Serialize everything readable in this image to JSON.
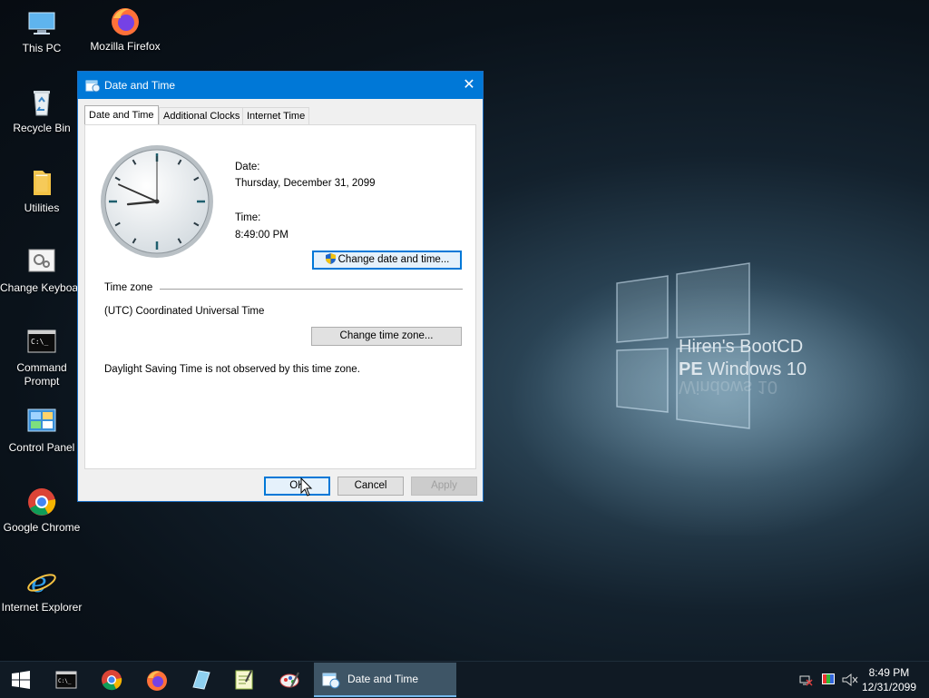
{
  "wallpaper": {
    "line1": "Hiren's BootCD",
    "line2_bold": "PE",
    "line2_rest": " Windows 10",
    "reflection": "Windows 10"
  },
  "desktop_icons": [
    {
      "label": "This PC",
      "icon": "computer-icon"
    },
    {
      "label": "Mozilla Firefox",
      "icon": "firefox-icon"
    },
    {
      "label": "Recycle Bin",
      "icon": "recycle-bin-icon"
    },
    {
      "label": "Utilities",
      "icon": "folder-icon"
    },
    {
      "label": "Change Keyboard Layout",
      "icon": "keyboard-settings-icon"
    },
    {
      "label": "Command Prompt",
      "icon": "cmd-icon"
    },
    {
      "label": "Control Panel",
      "icon": "control-panel-icon"
    },
    {
      "label": "Google Chrome",
      "icon": "chrome-icon"
    },
    {
      "label": "Internet Explorer",
      "icon": "ie-icon"
    }
  ],
  "dialog": {
    "title": "Date and Time",
    "close_glyph": "✕",
    "tabs": [
      "Date and Time",
      "Additional Clocks",
      "Internet Time"
    ],
    "date_label": "Date:",
    "date_value": "Thursday, December 31, 2099",
    "time_label": "Time:",
    "time_value": "8:49:00 PM",
    "change_datetime_button": "Change date and time...",
    "timezone_header": "Time zone",
    "timezone_value": "(UTC) Coordinated Universal Time",
    "change_timezone_button": "Change time zone...",
    "dst_note": "Daylight Saving Time is not observed by this time zone.",
    "ok_button": "OK",
    "cancel_button": "Cancel",
    "apply_button": "Apply"
  },
  "clock_face": {
    "hour": 8,
    "minute": 49,
    "second": 0
  },
  "taskbar": {
    "pinned": [
      "start-icon",
      "cmd-icon",
      "chrome-icon",
      "firefox-icon",
      "explorer-icon",
      "notepad-icon",
      "paint-icon"
    ],
    "active_window": "Date and Time",
    "time": "8:49 PM",
    "date": "12/31/2099"
  },
  "colors": {
    "accent": "#0078d7",
    "taskbar": "#101a24"
  }
}
